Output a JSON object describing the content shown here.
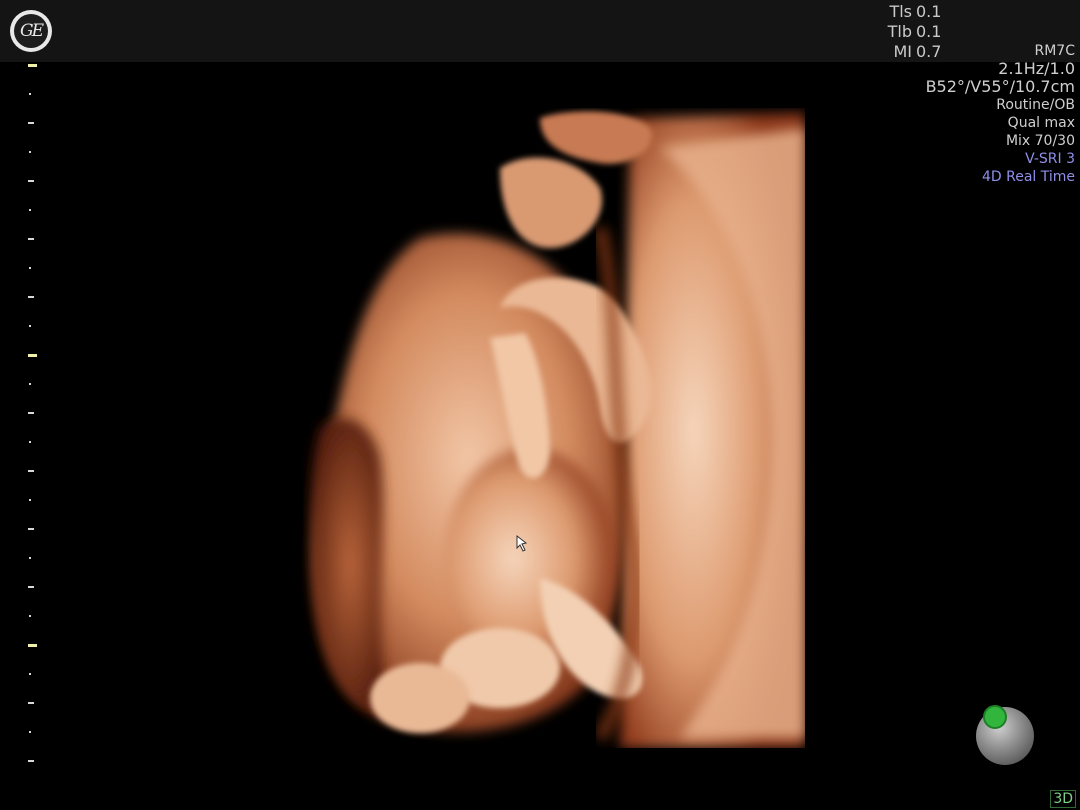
{
  "header": {
    "safety": [
      {
        "label": "Tls",
        "value": "0.1"
      },
      {
        "label": "Tlb",
        "value": "0.1"
      },
      {
        "label": "MI",
        "value": "0.7"
      }
    ],
    "probe": "RM7C"
  },
  "params": {
    "frame_rate": "2.1Hz/1.0",
    "volume": "B52°/V55°/10.7cm",
    "preset": "Routine/OB",
    "quality": "Qual max",
    "mix": "Mix 70/30",
    "sri": "V-SRI 3",
    "mode": "4D Real Time"
  },
  "footer": {
    "view_mode": "3D"
  },
  "icons": {
    "logo": "ge-logo",
    "cursor": "hand-cursor-icon",
    "orientation": "orientation-sphere-icon"
  },
  "colors": {
    "accent_text": "#8f8fe8",
    "scale_major": "#f0efa8",
    "orientation_marker": "#31b53c"
  }
}
